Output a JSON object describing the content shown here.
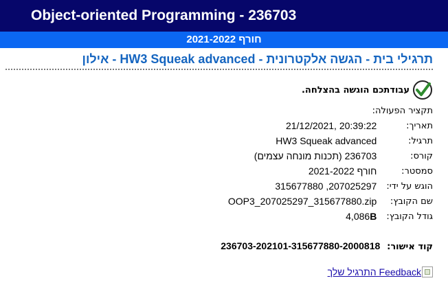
{
  "header": {
    "course_title": "Object-oriented Programming - 236703",
    "semester": "חורף 2021-2022"
  },
  "assignment": {
    "title": "תרגילי בית - הגשה אלקטרונית - HW3 Squeak advanced - אילון"
  },
  "status": {
    "icon": "checkmark-icon",
    "message": "עבודתכם הוגשה בהצלחה."
  },
  "summary": {
    "label": "תקציר הפעולה:",
    "rows": [
      {
        "key": "תאריך:",
        "value": "20:39:22 ,21/12/2021"
      },
      {
        "key": "תרגיל:",
        "value": "HW3 Squeak advanced"
      },
      {
        "key": "קורס:",
        "value": "236703 (תכנות מונחה עצמים)"
      },
      {
        "key": "סמסטר:",
        "value": "חורף 2021-2022"
      },
      {
        "key": "הוגש על ידי:",
        "value": "207025297, 315677880"
      },
      {
        "key": "שם הקובץ:",
        "value": "OOP3_207025297_315677880.zip"
      },
      {
        "key": "גודל הקובץ:",
        "value_number": "4,086",
        "value_unit": "B"
      }
    ]
  },
  "approval": {
    "label": "קוד אישור:",
    "code": "236703-202101-315677880-2000818"
  },
  "feedback": {
    "link_text": "Feedback התרגיל שלך",
    "icon": "broken-image-icon"
  },
  "colors": {
    "header_bg": "#06066a",
    "semester_bg": "#0b67f2",
    "title_link": "#1565c0",
    "check_green": "#2e8b2e"
  }
}
